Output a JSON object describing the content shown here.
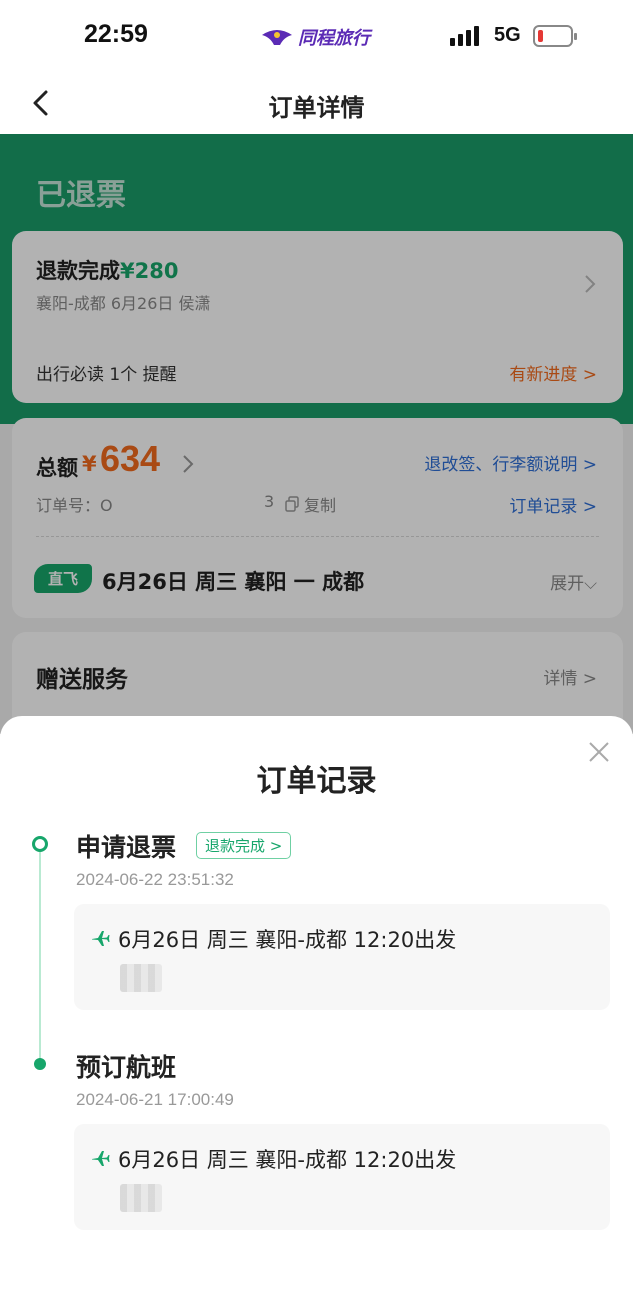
{
  "status_bar": {
    "time": "22:59",
    "brand": "同程旅行",
    "network": "5G"
  },
  "nav": {
    "title": "订单详情"
  },
  "header": {
    "status": "已退票"
  },
  "refund_card": {
    "title_prefix": "退款完成",
    "amount": "¥280",
    "subtitle": "襄阳-成都 6月26日 侯潇",
    "footer_label": "出行必读 1个 提醒",
    "footer_link": "有新进度 >"
  },
  "total_card": {
    "label": "总额",
    "currency": "¥",
    "amount": "634",
    "policy_link": "退改签、行李额说明 >",
    "order_label": "订单号：O",
    "order_suffix": "3",
    "copy_label": "复制",
    "record_link": "订单记录 >",
    "badge": "直飞",
    "flight": "6月26日 周三 襄阳 一 成都",
    "expand": "展开⌵"
  },
  "gift_card": {
    "title": "赠送服务",
    "detail": "详情 >"
  },
  "sheet": {
    "title": "订单记录",
    "events": [
      {
        "title": "申请退票",
        "badge": "退款完成 >",
        "time": "2024-06-22 23:51:32",
        "flight": "6月26日 周三 襄阳-成都 12:20出发"
      },
      {
        "title": "预订航班",
        "time": "2024-06-21 17:00:49",
        "flight": "6月26日 周三 襄阳-成都 12:20出发"
      }
    ]
  },
  "colors": {
    "brand_green": "#1a9c69",
    "accent_orange": "#f26b1d",
    "link_blue": "#2f6fd6"
  }
}
